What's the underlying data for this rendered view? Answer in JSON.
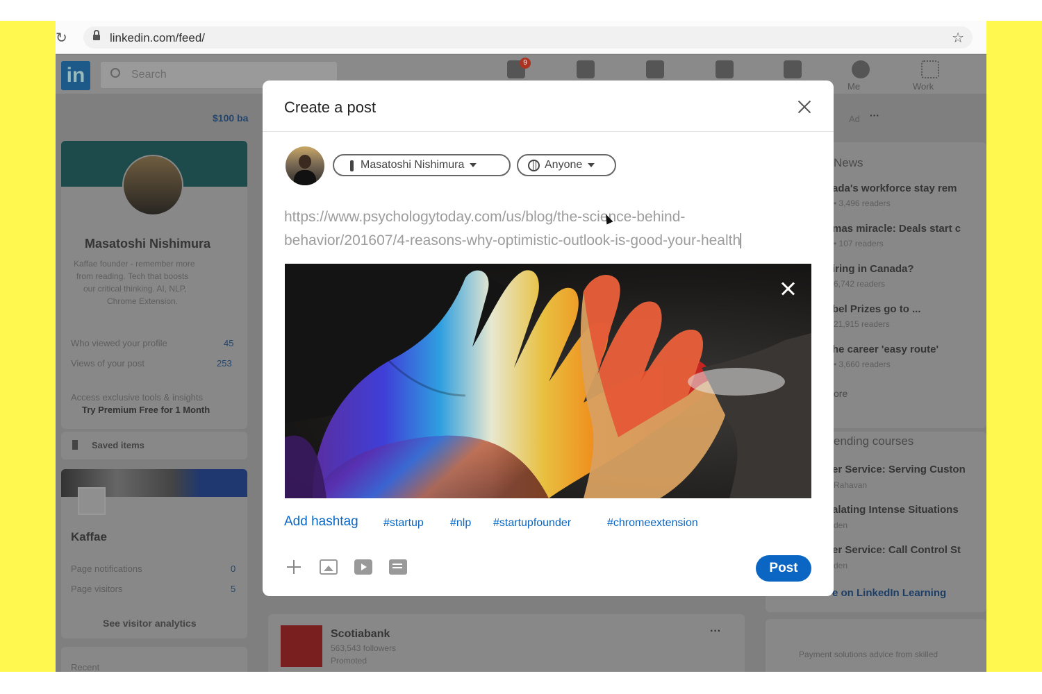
{
  "browser": {
    "url": "linkedin.com/feed/"
  },
  "linkedin": {
    "search_placeholder": "Search",
    "nav_me": "Me",
    "nav_work": "Work",
    "banner_promo": "$100 ba",
    "profile": {
      "name": "Masatoshi Nishimura",
      "bio_lines": [
        "Kaffae founder - remember more",
        "from reading. Tech that boosts",
        "our critical thinking. AI, NLP,",
        "Chrome Extension."
      ],
      "stats": [
        {
          "label": "Who viewed your profile",
          "value": "45"
        },
        {
          "label": "Views of your post",
          "value": "253"
        }
      ],
      "premium_note": "Access exclusive tools & insights",
      "premium_cta": "Try Premium Free for 1 Month",
      "saved_items": "Saved items"
    },
    "page": {
      "name": "Kaffae",
      "rows": [
        {
          "label": "Page notifications",
          "value": "0"
        },
        {
          "label": "Page visitors",
          "value": "5"
        }
      ],
      "analytics": "See visitor analytics",
      "recent": "Recent"
    },
    "feed_post": {
      "company": "Scotiabank",
      "followers": "563,543 followers",
      "promoted": "Promoted",
      "more": "···"
    },
    "right": {
      "ad": "Ad",
      "ad_more": "···",
      "news_title": "News",
      "news": [
        {
          "title": "ada's workforce stay rem",
          "meta": "• 3,496 readers"
        },
        {
          "title": "mas miracle: Deals start c",
          "meta": "• 107 readers"
        },
        {
          "title": "iring in Canada?",
          "meta": "6,742 readers"
        },
        {
          "title": "bel Prizes go to ...",
          "meta": "21,915 readers"
        },
        {
          "title": "he career 'easy route'",
          "meta": "• 3,660 readers"
        }
      ],
      "show_more": "ore",
      "courses_title": "ending courses",
      "courses": [
        {
          "title": "er Service: Serving Custon",
          "meta": "Rahavan"
        },
        {
          "title": "alating Intense Situations",
          "meta": "den"
        },
        {
          "title": "er Service: Call Control St",
          "meta": "den"
        }
      ],
      "learning_link": "e on LinkedIn Learning",
      "footer_ad": "Payment solutions advice from skilled"
    }
  },
  "modal": {
    "title": "Create a post",
    "author": "Masatoshi Nishimura",
    "visibility": "Anyone",
    "post_text_line1": "https://www.psychologytoday.com/us/blog/the-science-behind-",
    "post_text_line2": "behavior/201607/4-reasons-why-optimistic-outlook-is-good-your-health",
    "add_hashtag": "Add hashtag",
    "hashtags": [
      "#startup",
      "#nlp",
      "#startupfounder",
      "#chromeextension"
    ],
    "post_button": "Post"
  },
  "colors": {
    "accent": "#0a66c2",
    "side_bars": "#fff94f"
  }
}
